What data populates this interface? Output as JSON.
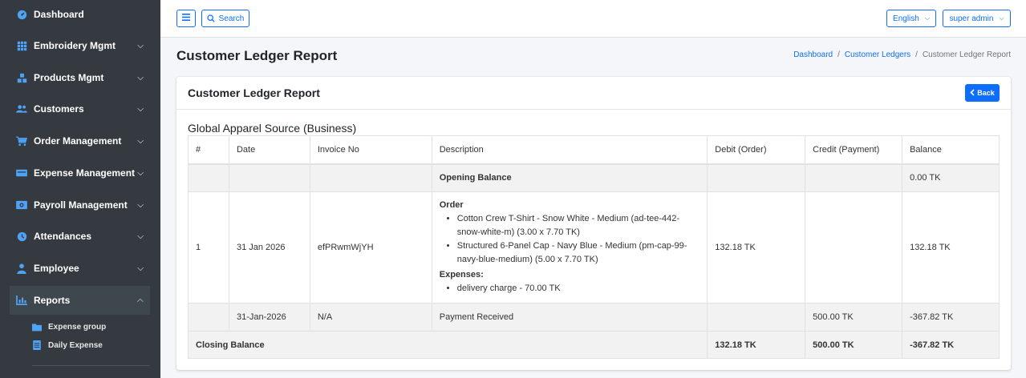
{
  "sidebar": {
    "items": [
      {
        "label": "Dashboard",
        "icon": "gauge-icon",
        "has_chevron": false
      },
      {
        "label": "Embroidery Mgmt",
        "icon": "grid-icon",
        "has_chevron": true
      },
      {
        "label": "Products Mgmt",
        "icon": "boxes-icon",
        "has_chevron": true
      },
      {
        "label": "Customers",
        "icon": "users-icon",
        "has_chevron": true
      },
      {
        "label": "Order Management",
        "icon": "cart-icon",
        "has_chevron": true
      },
      {
        "label": "Expense Management",
        "icon": "money-icon",
        "has_chevron": true
      },
      {
        "label": "Payroll Management",
        "icon": "payroll-icon",
        "has_chevron": true
      },
      {
        "label": "Attendances",
        "icon": "clock-icon",
        "has_chevron": true
      },
      {
        "label": "Employee",
        "icon": "user-icon",
        "has_chevron": true
      },
      {
        "label": "Reports",
        "icon": "chart-icon",
        "has_chevron": true,
        "expanded": true
      }
    ],
    "sub_items": [
      {
        "label": "Expense group",
        "icon": "folder-icon"
      },
      {
        "label": "Daily Expense",
        "icon": "document-icon"
      }
    ]
  },
  "topbar": {
    "search_label": "Search",
    "language": "English",
    "user": "super admin"
  },
  "header": {
    "title": "Customer Ledger Report",
    "breadcrumb": [
      "Dashboard",
      "Customer Ledgers",
      "Customer Ledger Report"
    ]
  },
  "card": {
    "title": "Customer Ledger Report",
    "back_label": "Back",
    "company": "Global Apparel Source (Business)"
  },
  "table": {
    "headers": [
      "#",
      "Date",
      "Invoice No",
      "Description",
      "Debit (Order)",
      "Credit (Payment)",
      "Balance"
    ],
    "opening": {
      "label": "Opening Balance",
      "balance": "0.00 TK"
    },
    "order_row": {
      "num": "1",
      "date": "31 Jan 2026",
      "invoice": "efPRwmWjYH",
      "order_heading": "Order",
      "order_items": [
        "Cotton Crew T-Shirt - Snow White - Medium (ad-tee-442-snow-white-m) (3.00 x 7.70 TK)",
        "Structured 6-Panel Cap - Navy Blue - Medium (pm-cap-99-navy-blue-medium) (5.00 x 7.70 TK)"
      ],
      "expenses_heading": "Expenses:",
      "expense_items": [
        "delivery charge - 70.00 TK"
      ],
      "debit": "132.18 TK",
      "credit": "",
      "balance": "132.18 TK"
    },
    "payment_row": {
      "num": "",
      "date": "31-Jan-2026",
      "invoice": "N/A",
      "description": "Payment Received",
      "debit": "",
      "credit": "500.00 TK",
      "balance": "-367.82 TK"
    },
    "closing": {
      "label": "Closing Balance",
      "debit": "132.18 TK",
      "credit": "500.00 TK",
      "balance": "-367.82 TK"
    }
  },
  "colors": {
    "sidebar_bg": "#343a40",
    "accent": "#0d6efd",
    "sidebar_icon": "#4fa3f7"
  }
}
